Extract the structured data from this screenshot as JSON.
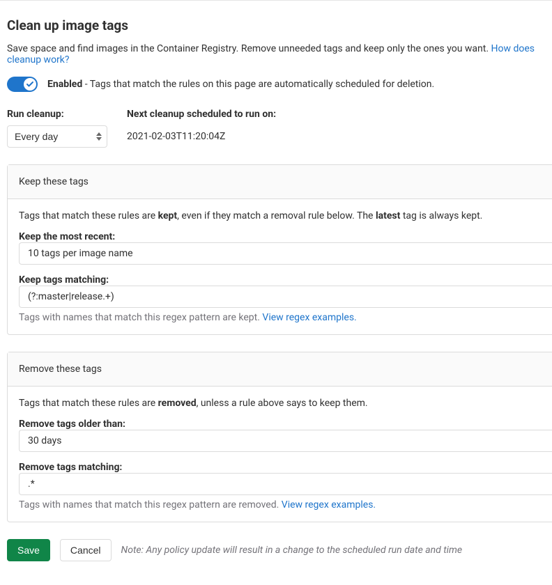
{
  "header": {
    "title": "Clean up image tags",
    "description_prefix": "Save space and find images in the Container Registry. Remove unneeded tags and keep only the ones you want. ",
    "help_link_text": "How does cleanup work?"
  },
  "toggle": {
    "enabled_label": "Enabled",
    "description": " - Tags that match the rules on this page are automatically scheduled for deletion."
  },
  "run_cleanup": {
    "label": "Run cleanup:",
    "selected": "Every day"
  },
  "next_cleanup": {
    "label": "Next cleanup scheduled to run on:",
    "value": "2021-02-03T11:20:04Z"
  },
  "keep_panel": {
    "header": "Keep these tags",
    "intro_prefix": "Tags that match these rules are ",
    "kept": "kept",
    "intro_mid": ", even if they match a removal rule below. The ",
    "latest": "latest",
    "intro_suffix": " tag is always kept.",
    "most_recent": {
      "label": "Keep the most recent:",
      "value": "10 tags per image name"
    },
    "matching": {
      "label": "Keep tags matching:",
      "value": "(?:master|release.+)",
      "help_prefix": "Tags with names that match this regex pattern are kept. ",
      "help_link": "View regex examples."
    }
  },
  "remove_panel": {
    "header": "Remove these tags",
    "intro_prefix": "Tags that match these rules are ",
    "removed": "removed",
    "intro_suffix": ", unless a rule above says to keep them.",
    "older_than": {
      "label": "Remove tags older than:",
      "value": "30 days"
    },
    "matching": {
      "label": "Remove tags matching:",
      "value": ".*",
      "help_prefix": "Tags with names that match this regex pattern are removed. ",
      "help_link": "View regex examples."
    }
  },
  "footer": {
    "save": "Save",
    "cancel": "Cancel",
    "note": "Note: Any policy update will result in a change to the scheduled run date and time"
  }
}
